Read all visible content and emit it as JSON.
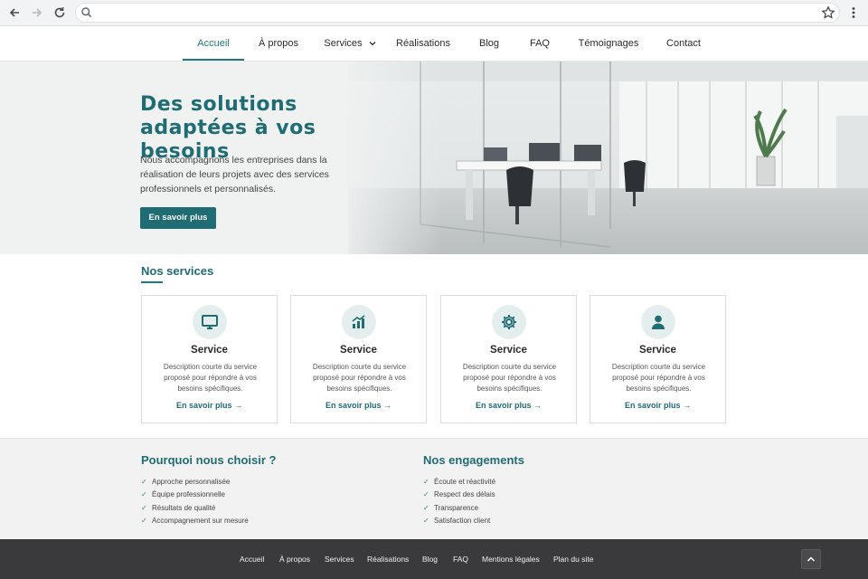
{
  "browser": {
    "url": ""
  },
  "nav": {
    "items": [
      {
        "label": "Accueil"
      },
      {
        "label": "À propos"
      },
      {
        "label": "Services"
      },
      {
        "label": "Réalisations"
      },
      {
        "label": "Blog"
      },
      {
        "label": "FAQ"
      },
      {
        "label": "Témoignages"
      },
      {
        "label": "Contact"
      }
    ]
  },
  "hero": {
    "title_line1": "Des solutions",
    "title_line2": "adaptées à vos besoins",
    "text": "Nous accompagnons les entreprises dans la réalisation de leurs projets avec des services professionnels et personnalisés.",
    "button": "En savoir plus"
  },
  "services": {
    "title": "Nos services",
    "cards": [
      {
        "icon": "monitor-icon",
        "title": "Service",
        "desc": "Description courte du service proposé pour répondre à vos besoins spécifiques.",
        "link": "En savoir plus →"
      },
      {
        "icon": "chart-icon",
        "title": "Service",
        "desc": "Description courte du service proposé pour répondre à vos besoins spécifiques.",
        "link": "En savoir plus →"
      },
      {
        "icon": "gear-icon",
        "title": "Service",
        "desc": "Description courte du service proposé pour répondre à vos besoins spécifiques.",
        "link": "En savoir plus →"
      },
      {
        "icon": "user-icon",
        "title": "Service",
        "desc": "Description courte du service proposé pour répondre à vos besoins spécifiques.",
        "link": "En savoir plus →"
      }
    ]
  },
  "why": {
    "title": "Pourquoi nous choisir ?",
    "items": [
      "Approche personnalisée",
      "Équipe professionnelle",
      "Résultats de qualité",
      "Accompagnement sur mesure"
    ]
  },
  "commitments": {
    "title": "Nos engagements",
    "items": [
      "Écoute et réactivité",
      "Respect des délais",
      "Transparence",
      "Satisfaction client"
    ]
  },
  "footer": {
    "links": [
      "Accueil",
      "À propos",
      "Services",
      "Réalisations",
      "Blog",
      "FAQ",
      "Mentions légales",
      "Plan du site"
    ]
  },
  "colors": {
    "accent": "#1f6c74",
    "footer_bg": "#3a3a3c"
  }
}
